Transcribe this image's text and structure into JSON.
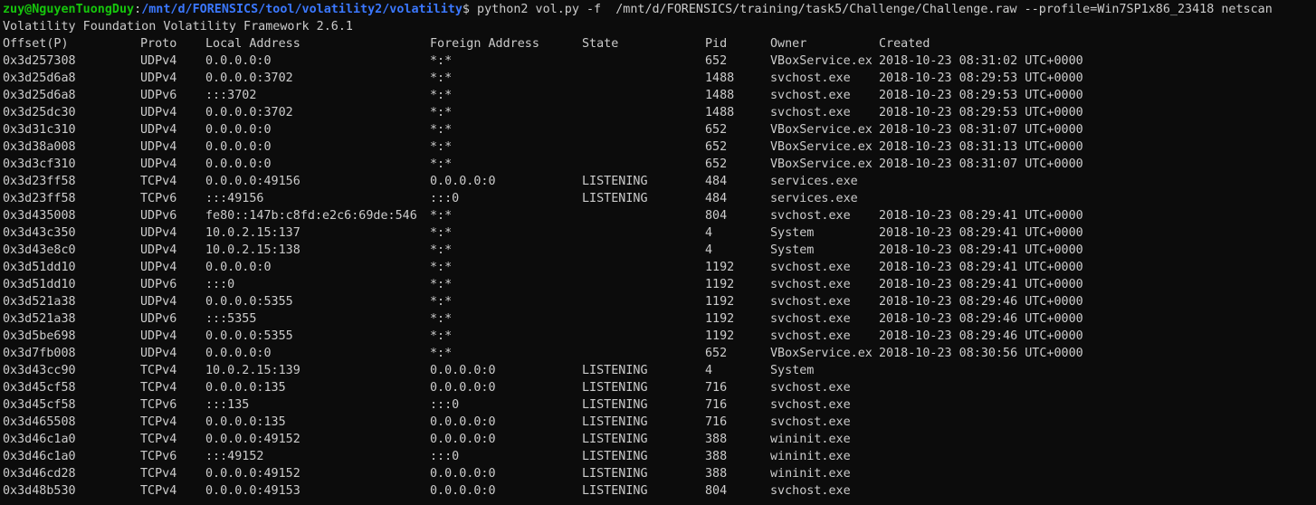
{
  "prompt": {
    "user_host": "zuy@NguyenTuongDuy",
    "path": "/mnt/d/FORENSICS/tool/volatility2/volatility",
    "symbol": "$",
    "command": " python2 vol.py -f  /mnt/d/FORENSICS/training/task5/Challenge/Challenge.raw --profile=Win7SP1x86_23418 netscan"
  },
  "banner": "Volatility Foundation Volatility Framework 2.6.1",
  "headers": {
    "offset": "Offset(P)",
    "proto": "Proto",
    "local": "Local Address",
    "foreign": "Foreign Address",
    "state": "State",
    "pid": "Pid",
    "owner": "Owner",
    "created": "Created"
  },
  "rows": [
    {
      "offset": "0x3d257308",
      "proto": "UDPv4",
      "local": "0.0.0.0:0",
      "foreign": "*:*",
      "state": "",
      "pid": "652",
      "owner": "VBoxService.ex",
      "created": "2018-10-23 08:31:02 UTC+0000"
    },
    {
      "offset": "0x3d25d6a8",
      "proto": "UDPv4",
      "local": "0.0.0.0:3702",
      "foreign": "*:*",
      "state": "",
      "pid": "1488",
      "owner": "svchost.exe",
      "created": "2018-10-23 08:29:53 UTC+0000"
    },
    {
      "offset": "0x3d25d6a8",
      "proto": "UDPv6",
      "local": ":::3702",
      "foreign": "*:*",
      "state": "",
      "pid": "1488",
      "owner": "svchost.exe",
      "created": "2018-10-23 08:29:53 UTC+0000"
    },
    {
      "offset": "0x3d25dc30",
      "proto": "UDPv4",
      "local": "0.0.0.0:3702",
      "foreign": "*:*",
      "state": "",
      "pid": "1488",
      "owner": "svchost.exe",
      "created": "2018-10-23 08:29:53 UTC+0000"
    },
    {
      "offset": "0x3d31c310",
      "proto": "UDPv4",
      "local": "0.0.0.0:0",
      "foreign": "*:*",
      "state": "",
      "pid": "652",
      "owner": "VBoxService.ex",
      "created": "2018-10-23 08:31:07 UTC+0000"
    },
    {
      "offset": "0x3d38a008",
      "proto": "UDPv4",
      "local": "0.0.0.0:0",
      "foreign": "*:*",
      "state": "",
      "pid": "652",
      "owner": "VBoxService.ex",
      "created": "2018-10-23 08:31:13 UTC+0000"
    },
    {
      "offset": "0x3d3cf310",
      "proto": "UDPv4",
      "local": "0.0.0.0:0",
      "foreign": "*:*",
      "state": "",
      "pid": "652",
      "owner": "VBoxService.ex",
      "created": "2018-10-23 08:31:07 UTC+0000"
    },
    {
      "offset": "0x3d23ff58",
      "proto": "TCPv4",
      "local": "0.0.0.0:49156",
      "foreign": "0.0.0.0:0",
      "state": "LISTENING",
      "pid": "484",
      "owner": "services.exe",
      "created": ""
    },
    {
      "offset": "0x3d23ff58",
      "proto": "TCPv6",
      "local": ":::49156",
      "foreign": ":::0",
      "state": "LISTENING",
      "pid": "484",
      "owner": "services.exe",
      "created": ""
    },
    {
      "offset": "0x3d435008",
      "proto": "UDPv6",
      "local": "fe80::147b:c8fd:e2c6:69de:546",
      "foreign": "*:*",
      "state": "",
      "pid": "804",
      "owner": "svchost.exe",
      "created": "2018-10-23 08:29:41 UTC+0000"
    },
    {
      "offset": "0x3d43c350",
      "proto": "UDPv4",
      "local": "10.0.2.15:137",
      "foreign": "*:*",
      "state": "",
      "pid": "4",
      "owner": "System",
      "created": "2018-10-23 08:29:41 UTC+0000"
    },
    {
      "offset": "0x3d43e8c0",
      "proto": "UDPv4",
      "local": "10.0.2.15:138",
      "foreign": "*:*",
      "state": "",
      "pid": "4",
      "owner": "System",
      "created": "2018-10-23 08:29:41 UTC+0000"
    },
    {
      "offset": "0x3d51dd10",
      "proto": "UDPv4",
      "local": "0.0.0.0:0",
      "foreign": "*:*",
      "state": "",
      "pid": "1192",
      "owner": "svchost.exe",
      "created": "2018-10-23 08:29:41 UTC+0000"
    },
    {
      "offset": "0x3d51dd10",
      "proto": "UDPv6",
      "local": ":::0",
      "foreign": "*:*",
      "state": "",
      "pid": "1192",
      "owner": "svchost.exe",
      "created": "2018-10-23 08:29:41 UTC+0000"
    },
    {
      "offset": "0x3d521a38",
      "proto": "UDPv4",
      "local": "0.0.0.0:5355",
      "foreign": "*:*",
      "state": "",
      "pid": "1192",
      "owner": "svchost.exe",
      "created": "2018-10-23 08:29:46 UTC+0000"
    },
    {
      "offset": "0x3d521a38",
      "proto": "UDPv6",
      "local": ":::5355",
      "foreign": "*:*",
      "state": "",
      "pid": "1192",
      "owner": "svchost.exe",
      "created": "2018-10-23 08:29:46 UTC+0000"
    },
    {
      "offset": "0x3d5be698",
      "proto": "UDPv4",
      "local": "0.0.0.0:5355",
      "foreign": "*:*",
      "state": "",
      "pid": "1192",
      "owner": "svchost.exe",
      "created": "2018-10-23 08:29:46 UTC+0000"
    },
    {
      "offset": "0x3d7fb008",
      "proto": "UDPv4",
      "local": "0.0.0.0:0",
      "foreign": "*:*",
      "state": "",
      "pid": "652",
      "owner": "VBoxService.ex",
      "created": "2018-10-23 08:30:56 UTC+0000"
    },
    {
      "offset": "0x3d43cc90",
      "proto": "TCPv4",
      "local": "10.0.2.15:139",
      "foreign": "0.0.0.0:0",
      "state": "LISTENING",
      "pid": "4",
      "owner": "System",
      "created": ""
    },
    {
      "offset": "0x3d45cf58",
      "proto": "TCPv4",
      "local": "0.0.0.0:135",
      "foreign": "0.0.0.0:0",
      "state": "LISTENING",
      "pid": "716",
      "owner": "svchost.exe",
      "created": ""
    },
    {
      "offset": "0x3d45cf58",
      "proto": "TCPv6",
      "local": ":::135",
      "foreign": ":::0",
      "state": "LISTENING",
      "pid": "716",
      "owner": "svchost.exe",
      "created": ""
    },
    {
      "offset": "0x3d465508",
      "proto": "TCPv4",
      "local": "0.0.0.0:135",
      "foreign": "0.0.0.0:0",
      "state": "LISTENING",
      "pid": "716",
      "owner": "svchost.exe",
      "created": ""
    },
    {
      "offset": "0x3d46c1a0",
      "proto": "TCPv4",
      "local": "0.0.0.0:49152",
      "foreign": "0.0.0.0:0",
      "state": "LISTENING",
      "pid": "388",
      "owner": "wininit.exe",
      "created": ""
    },
    {
      "offset": "0x3d46c1a0",
      "proto": "TCPv6",
      "local": ":::49152",
      "foreign": ":::0",
      "state": "LISTENING",
      "pid": "388",
      "owner": "wininit.exe",
      "created": ""
    },
    {
      "offset": "0x3d46cd28",
      "proto": "TCPv4",
      "local": "0.0.0.0:49152",
      "foreign": "0.0.0.0:0",
      "state": "LISTENING",
      "pid": "388",
      "owner": "wininit.exe",
      "created": ""
    },
    {
      "offset": "0x3d48b530",
      "proto": "TCPv4",
      "local": "0.0.0.0:49153",
      "foreign": "0.0.0.0:0",
      "state": "LISTENING",
      "pid": "804",
      "owner": "svchost.exe",
      "created": ""
    }
  ],
  "colors": {
    "background": "#0c0c0c",
    "text": "#cccccc",
    "prompt_user": "#16c60c",
    "prompt_path": "#3b78ff"
  }
}
